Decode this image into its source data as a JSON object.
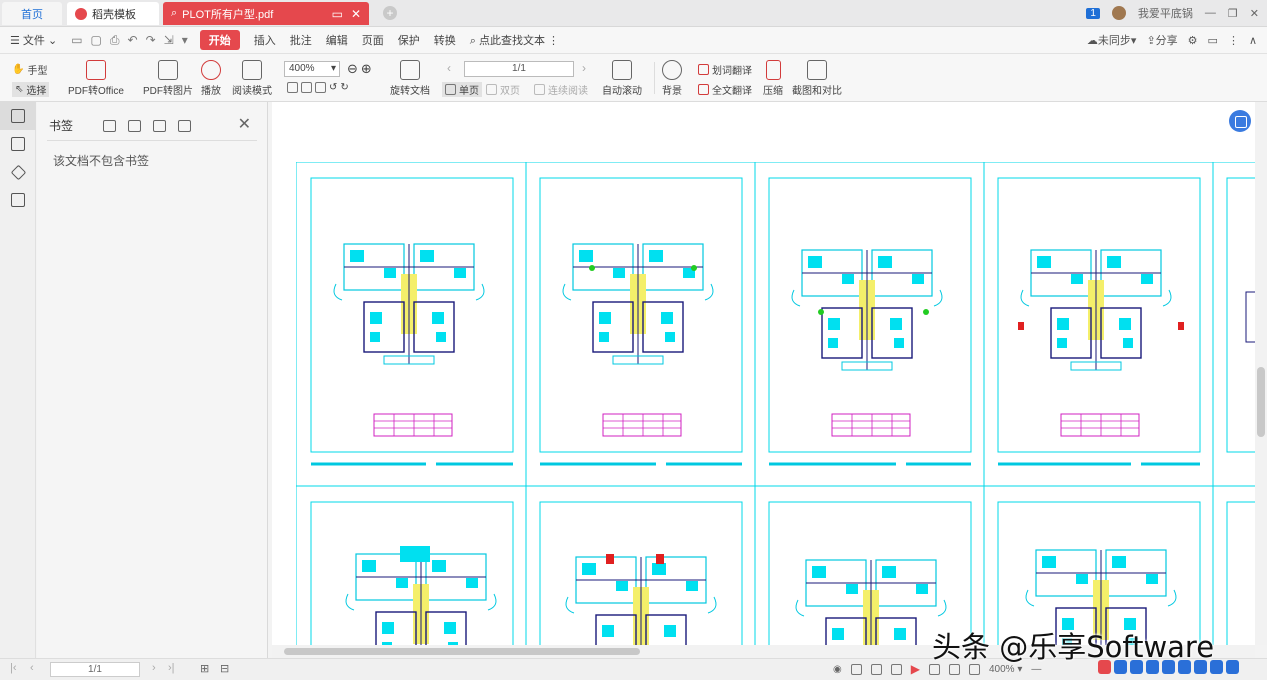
{
  "tabs": {
    "home": "首页",
    "template": "稻壳模板",
    "pdf": "PLOT所有户型.pdf"
  },
  "window": {
    "badge": "1",
    "user": "我爱平底锅"
  },
  "menu": {
    "file": "文件",
    "start": "开始",
    "insert": "插入",
    "annotate": "批注",
    "edit": "编辑",
    "page": "页面",
    "protect": "保护",
    "convert": "转换",
    "search": "点此查找文本",
    "sync": "未同步",
    "share": "分享"
  },
  "ribbon": {
    "hand": "手型",
    "select": "选择",
    "pdf_to_office": "PDF转Office",
    "pdf_to_image": "PDF转图片",
    "play": "播放",
    "read_mode": "阅读模式",
    "zoom": "400%",
    "rotate": "旋转文档",
    "page_input": "1/1",
    "single": "单页",
    "double": "双页",
    "continuous": "连续阅读",
    "auto_scroll": "自动滚动",
    "background": "背景",
    "word_translate": "划词翻译",
    "full_translate": "全文翻译",
    "compress": "压缩",
    "screenshot_compare": "截图和对比"
  },
  "bookmark": {
    "title": "书签",
    "empty": "该文档不包含书签"
  },
  "status": {
    "page": "1/1",
    "zoom": "400%"
  },
  "watermark": "头条 @乐享Software",
  "colors": {
    "accent": "#e5484d",
    "cad_cyan": "#00d8e8",
    "cad_magenta": "#d020c0"
  }
}
